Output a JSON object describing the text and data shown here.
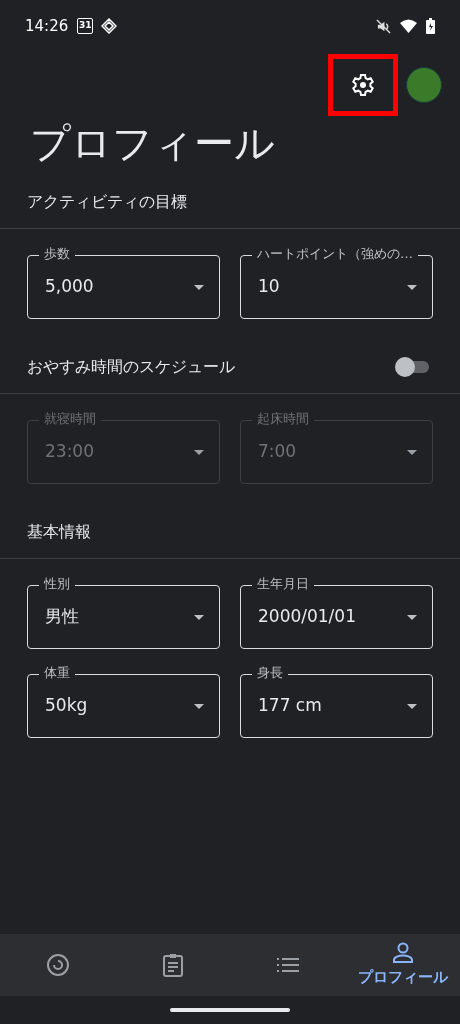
{
  "status_bar": {
    "time": "14:26",
    "calendar_day": "31"
  },
  "toolbar": {
    "settings_highlighted": true
  },
  "title": "プロフィール",
  "sections": [
    {
      "kind": "header",
      "title": "アクティビティの目標",
      "fields": [
        {
          "label": "歩数",
          "value": "5,000",
          "disabled": false
        },
        {
          "label": "ハートポイント（強めの…",
          "value": "10",
          "disabled": false
        }
      ]
    },
    {
      "kind": "toggle",
      "title": "おやすみ時間のスケジュール",
      "on": false,
      "fields": [
        {
          "label": "就寝時間",
          "value": "23:00",
          "disabled": true
        },
        {
          "label": "起床時間",
          "value": "7:00",
          "disabled": true
        }
      ]
    },
    {
      "kind": "header",
      "title": "基本情報",
      "fields": [
        {
          "label": "性別",
          "value": "男性",
          "disabled": false
        },
        {
          "label": "生年月日",
          "value": "2000/01/01",
          "disabled": false
        },
        {
          "label": "体重",
          "value": "50kg",
          "disabled": false
        },
        {
          "label": "身長",
          "value": "177 cm",
          "disabled": false
        }
      ]
    }
  ],
  "bottom_nav": [
    {
      "kind": "ring",
      "selected": false
    },
    {
      "kind": "clipboard",
      "selected": false
    },
    {
      "kind": "list",
      "selected": false
    },
    {
      "kind": "person",
      "label": "プロフィール",
      "selected": true
    }
  ]
}
